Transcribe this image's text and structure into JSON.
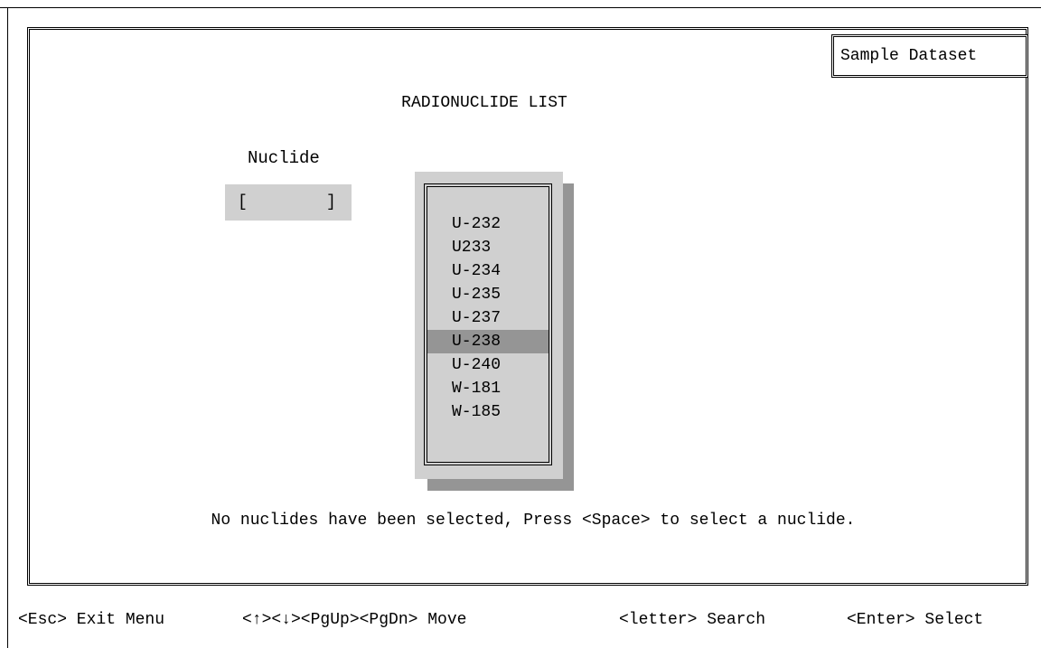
{
  "dataset_badge": "Sample Dataset",
  "title": "RADIONUCLIDE LIST",
  "nuclide_field": {
    "label": "Nuclide",
    "left_bracket": "[",
    "right_bracket": "]",
    "value": ""
  },
  "list": {
    "items": [
      "U-232",
      "U233",
      "U-234",
      "U-235",
      "U-237",
      "U-238",
      "U-240",
      "W-181",
      "W-185"
    ],
    "selected": "U-238"
  },
  "status_message": "No nuclides have been selected, Press <Space> to select a nuclide.",
  "footer": {
    "exit": "<Esc> Exit Menu",
    "move": "<↑><↓><PgUp><PgDn> Move",
    "search": "<letter> Search",
    "select": "<Enter> Select"
  },
  "colors": {
    "field_bg": "#d0d0d0",
    "highlight": "#959595",
    "border": "#000000"
  }
}
